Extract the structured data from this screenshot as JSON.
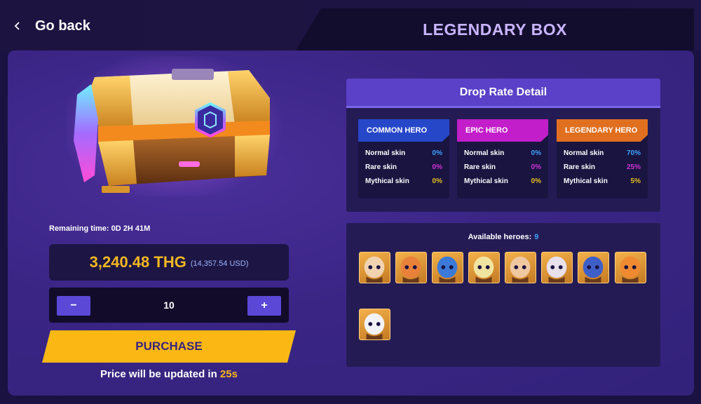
{
  "nav": {
    "back_label": "Go back",
    "back_icon": "chevron-left-icon"
  },
  "page_title": "LEGENDARY BOX",
  "purchase_panel": {
    "remaining_label": "Remaining time: 0D 2H 41M",
    "price_thg": "3,240.48 THG",
    "price_usd": "(14,357.54 USD)",
    "quantity": "10",
    "minus_label": "−",
    "plus_label": "+",
    "purchase_label": "PURCHASE",
    "update_prefix": "Price will be updated in ",
    "update_seconds": "25s"
  },
  "drop_rate": {
    "title": "Drop Rate Detail",
    "columns": [
      {
        "name": "COMMON HERO",
        "color": "#2747c9",
        "rows": [
          {
            "label": "Normal skin",
            "value": "0%"
          },
          {
            "label": "Rare skin",
            "value": "0%"
          },
          {
            "label": "Mythical skin",
            "value": "0%"
          }
        ]
      },
      {
        "name": "EPIC HERO",
        "color": "#c21ec9",
        "rows": [
          {
            "label": "Normal skin",
            "value": "0%"
          },
          {
            "label": "Rare skin",
            "value": "0%"
          },
          {
            "label": "Mythical skin",
            "value": "0%"
          }
        ]
      },
      {
        "name": "LEGENDARY HERO",
        "color": "#e07020",
        "rows": [
          {
            "label": "Normal skin",
            "value": "70%"
          },
          {
            "label": "Rare skin",
            "value": "25%"
          },
          {
            "label": "Mythical skin",
            "value": "5%"
          }
        ]
      }
    ]
  },
  "heroes": {
    "label": "Available heroes:",
    "count": "9",
    "portraits": [
      "hero-portrait-1",
      "hero-portrait-2",
      "hero-portrait-3",
      "hero-portrait-4",
      "hero-portrait-5",
      "hero-portrait-6",
      "hero-portrait-7",
      "hero-portrait-8",
      "hero-portrait-9"
    ]
  },
  "colors": {
    "accent": "#fbb815",
    "primary": "#5b48d6",
    "background": "#1a1240"
  }
}
